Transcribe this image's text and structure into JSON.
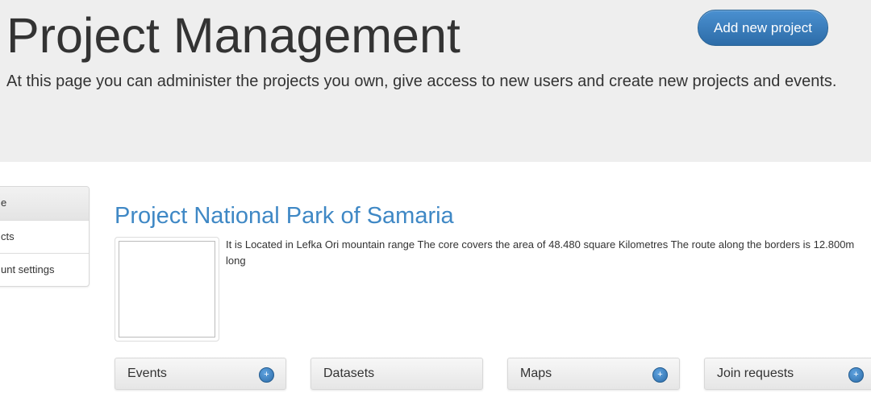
{
  "header": {
    "title": "Project Management",
    "description": "At this page you can administer the projects you own, give access to new users and create new projects and events.",
    "add_project_label": "Add new project"
  },
  "sidebar": {
    "items": [
      {
        "label": "e",
        "active": true
      },
      {
        "label": "cts",
        "active": false
      },
      {
        "label": "unt settings",
        "active": false
      }
    ]
  },
  "project": {
    "title": "Project National Park of Samaria",
    "description": "It is Located in Lefka Ori mountain range The core covers the area of 48.480 square Kilometres The route along the borders is 12.800m long"
  },
  "panels": [
    {
      "label": "Events",
      "has_add": true
    },
    {
      "label": "Datasets",
      "has_add": false
    },
    {
      "label": "Maps",
      "has_add": true
    },
    {
      "label": "Join requests",
      "has_add": true
    }
  ],
  "icons": {
    "add": "plus-icon"
  },
  "colors": {
    "accent": "#3f88c5",
    "button": "#2d6ca8",
    "hero_bg": "#eeeeee"
  }
}
